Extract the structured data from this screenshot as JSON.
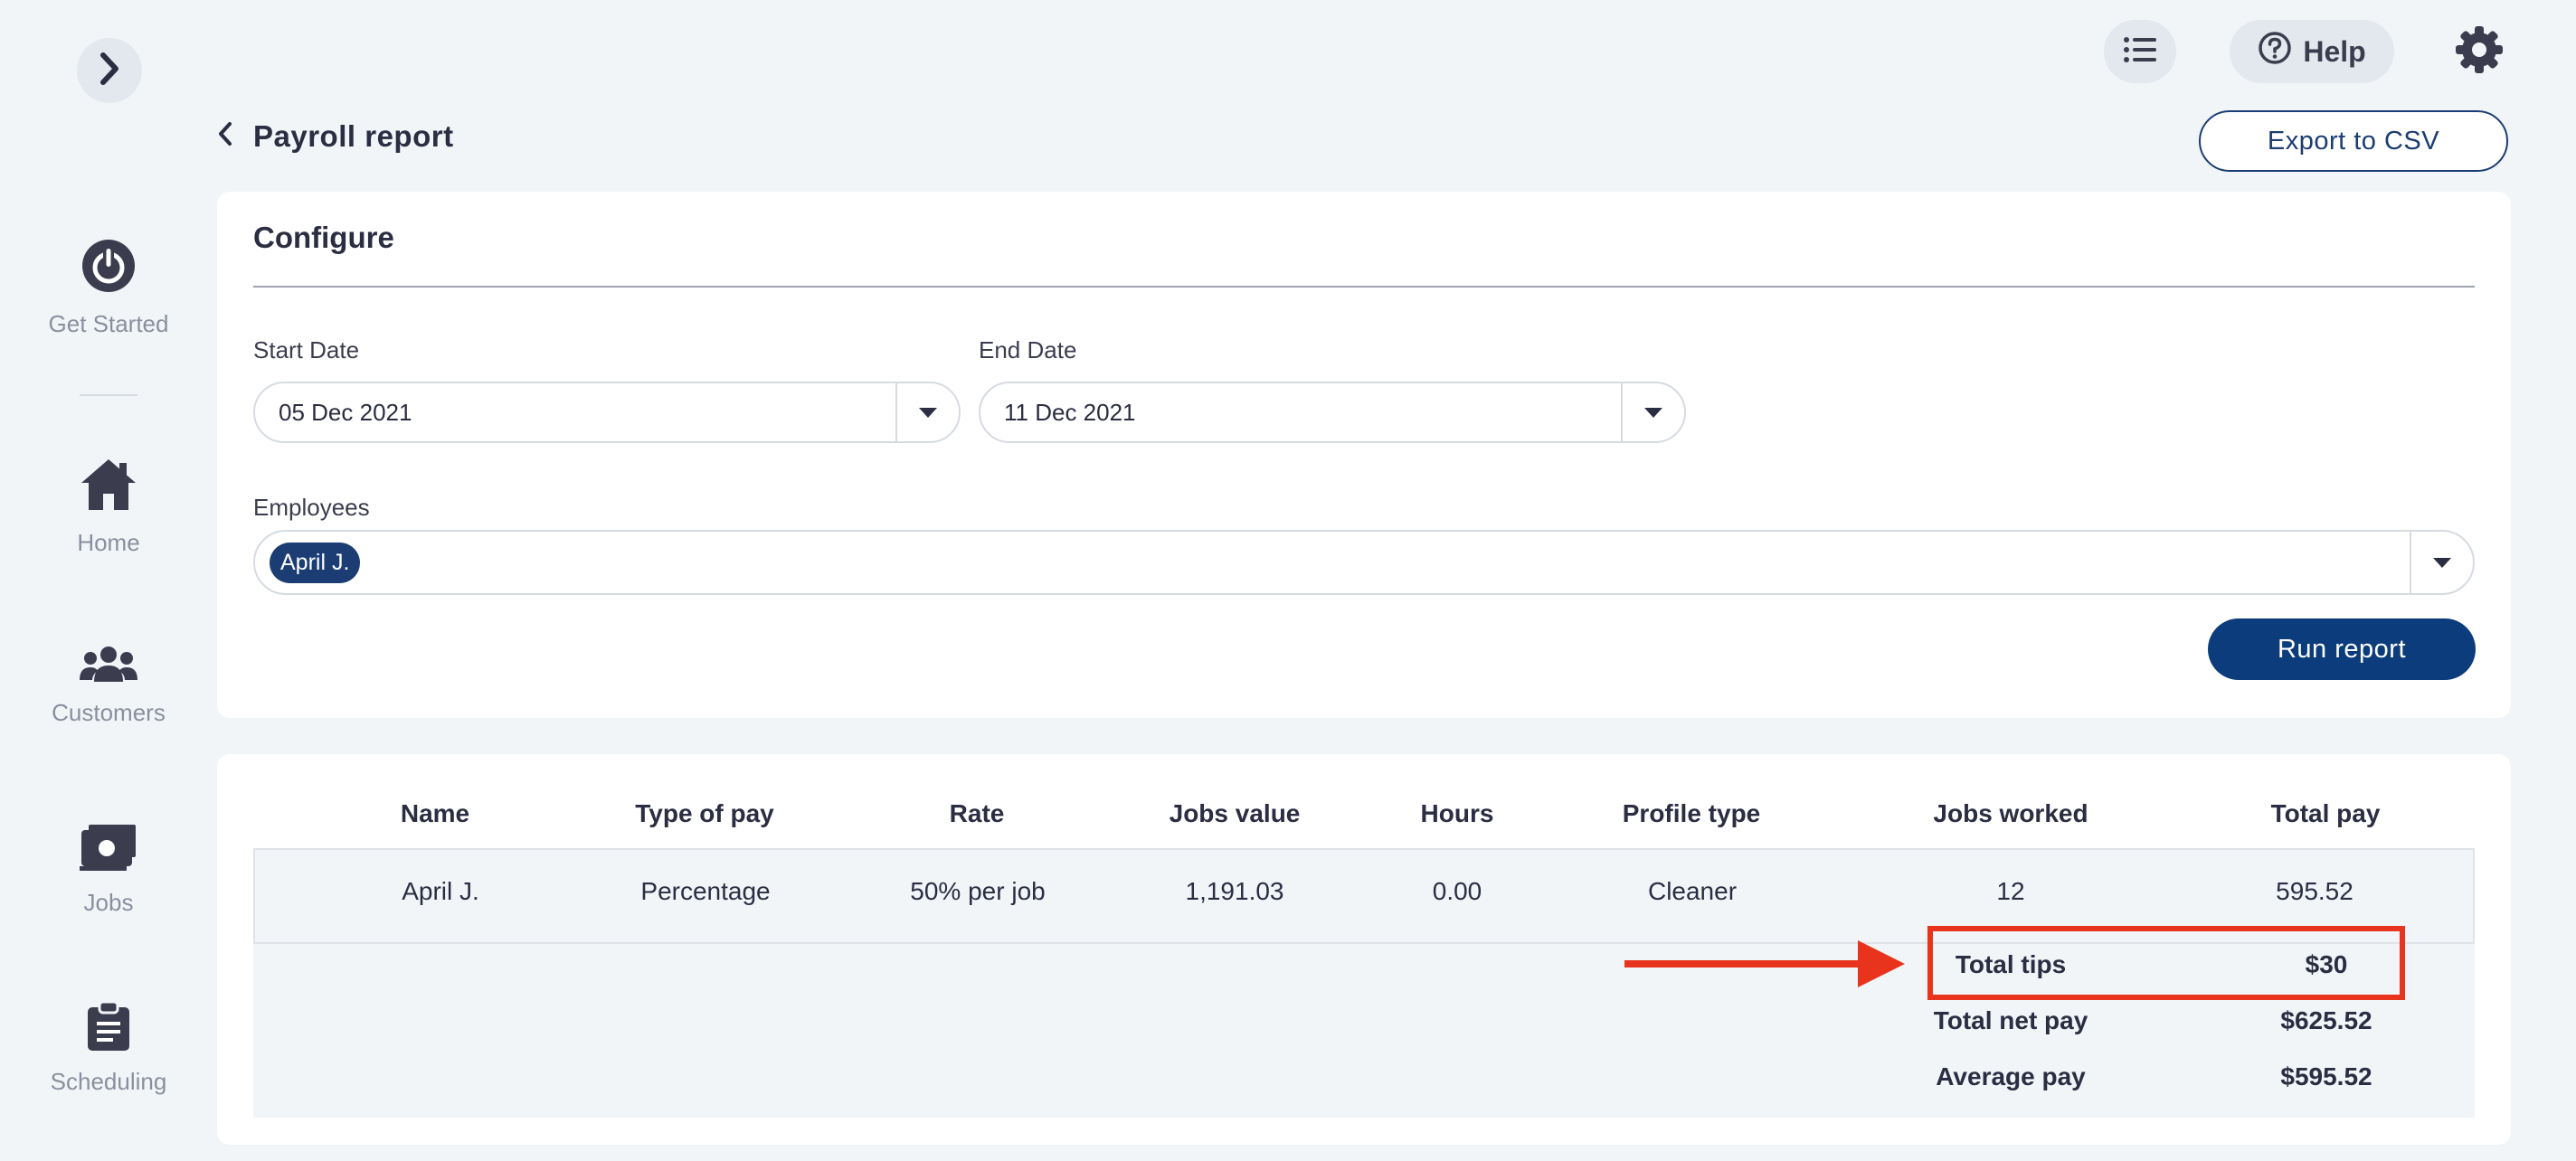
{
  "sidebar": {
    "items": [
      {
        "label": "Get Started",
        "icon": "power-icon"
      },
      {
        "label": "Home",
        "icon": "home-icon"
      },
      {
        "label": "Customers",
        "icon": "users-icon"
      },
      {
        "label": "Jobs",
        "icon": "money-icon"
      },
      {
        "label": "Scheduling",
        "icon": "clipboard-icon"
      }
    ]
  },
  "topbar": {
    "help_label": "Help"
  },
  "page": {
    "title": "Payroll report",
    "export_label": "Export to CSV"
  },
  "configure": {
    "title": "Configure",
    "start_date_label": "Start Date",
    "start_date_value": "05 Dec 2021",
    "end_date_label": "End Date",
    "end_date_value": "11 Dec 2021",
    "employees_label": "Employees",
    "employee_chip": "April J.",
    "run_label": "Run report"
  },
  "table": {
    "headers": [
      "Name",
      "Type of pay",
      "Rate",
      "Jobs value",
      "Hours",
      "Profile type",
      "Jobs worked",
      "Total pay"
    ],
    "rows": [
      [
        "April J.",
        "Percentage",
        "50% per job",
        "1,191.03",
        "0.00",
        "Cleaner",
        "12",
        "595.52"
      ]
    ]
  },
  "summary": {
    "total_tips_label": "Total tips",
    "total_tips_value": "$30",
    "total_net_pay_label": "Total net pay",
    "total_net_pay_value": "$625.52",
    "average_pay_label": "Average pay",
    "average_pay_value": "$595.52"
  },
  "colors": {
    "brand": "#0c3c7c",
    "highlight": "#e8341c",
    "background": "#f1f5f8"
  }
}
